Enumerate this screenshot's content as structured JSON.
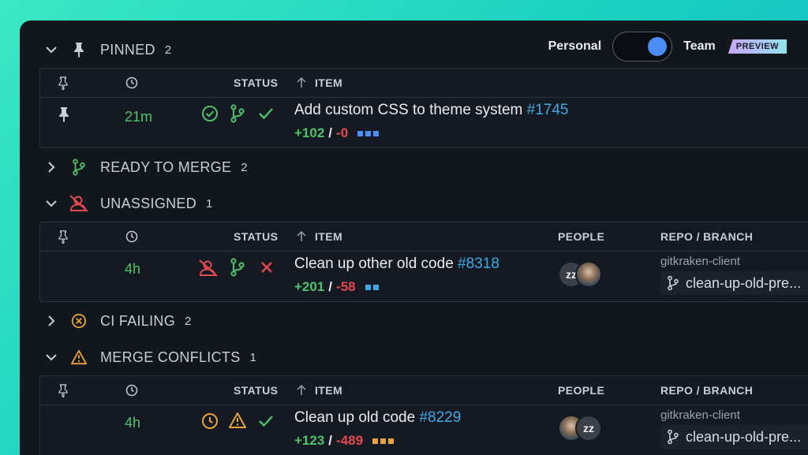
{
  "toggle": {
    "personal": "Personal",
    "team": "Team",
    "preview": "PREVIEW"
  },
  "headers": {
    "status": "STATUS",
    "item": "ITEM",
    "people": "PEOPLE",
    "repo": "REPO / BRANCH"
  },
  "sections": {
    "pinned": {
      "title": "PINNED",
      "count": "2"
    },
    "ready": {
      "title": "READY TO MERGE",
      "count": "2"
    },
    "unassigned": {
      "title": "UNASSIGNED",
      "count": "1"
    },
    "ci": {
      "title": "CI FAILING",
      "count": "2"
    },
    "conflicts": {
      "title": "MERGE CONFLICTS",
      "count": "1"
    }
  },
  "rows": {
    "pinned": {
      "time": "21m",
      "title": "Add custom CSS to theme system",
      "number": "#1745",
      "plus": "+102",
      "slash": "/",
      "minus": "-0"
    },
    "unassigned": {
      "time": "4h",
      "title": "Clean up other old code",
      "number": "#8318",
      "plus": "+201",
      "slash": "/",
      "minus": "-58",
      "repo": "gitkraken-client",
      "branch": "clean-up-old-pre..."
    },
    "conflicts": {
      "time": "4h",
      "title": "Clean up old code",
      "number": "#8229",
      "plus": "+123",
      "slash": "/",
      "minus": "-489",
      "repo": "gitkraken-client",
      "branch": "clean-up-old-pre..."
    }
  },
  "colors": {
    "green": "#4ec36a",
    "red": "#e5484d",
    "orange": "#e8a33d",
    "blue": "#3fa9e8",
    "accent": "#4b8df8"
  },
  "avatar_text": "z"
}
